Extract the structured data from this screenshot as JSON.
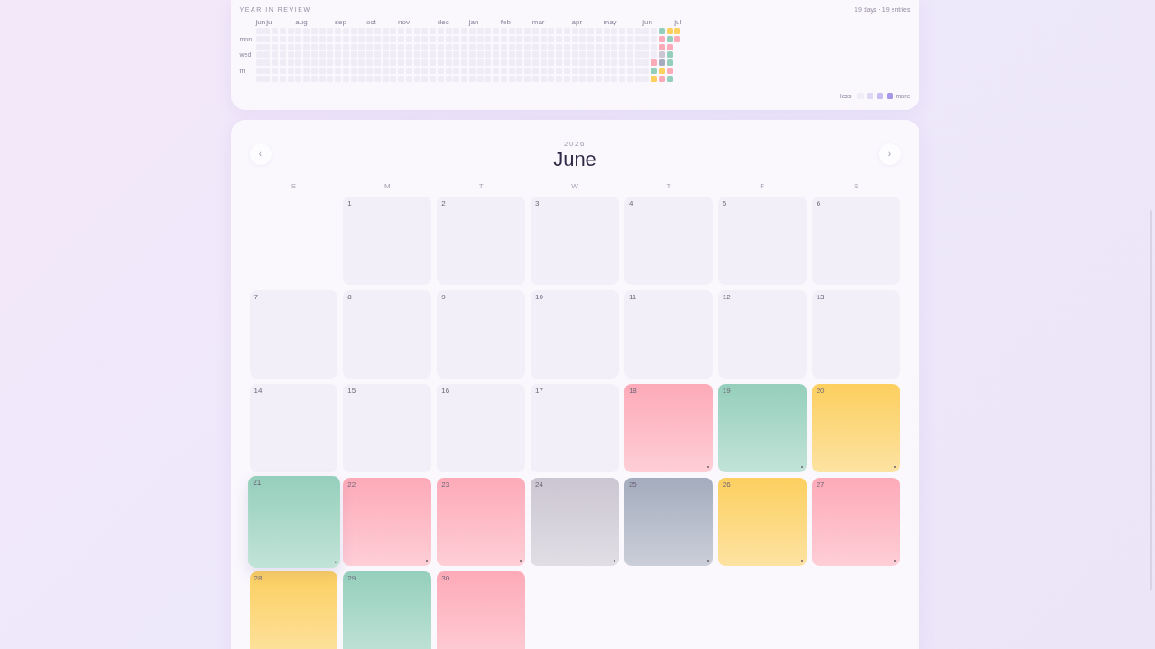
{
  "year_in_review": {
    "title": "YEAR IN REVIEW",
    "summary": "19 days · 19 entries",
    "day_labels": [
      "mon",
      "wed",
      "fri"
    ],
    "weeks": [
      {
        "month": "jun",
        "days": [
          {
            "color": "#f0ecf6"
          },
          {
            "color": "#f0ecf6"
          },
          {
            "color": "#f0ecf6"
          },
          {
            "color": "#f0ecf6"
          },
          {
            "color": "#f0ecf6"
          },
          {
            "color": "#f0ecf6"
          },
          {
            "color": "#f0ecf6"
          }
        ]
      },
      {
        "month": "jul",
        "days": [
          {
            "color": "#f0ecf6"
          },
          {
            "color": "#f0ecf6"
          },
          {
            "color": "#f0ecf6"
          },
          {
            "color": "#f0ecf6"
          },
          {
            "color": "#f0ecf6"
          },
          {
            "color": "#f0ecf6"
          },
          {
            "color": "#f0ecf6"
          }
        ]
      },
      {
        "days": [
          {
            "color": "#f0ecf6"
          },
          {
            "color": "#f0ecf6"
          },
          {
            "color": "#f0ecf6"
          },
          {
            "color": "#f0ecf6"
          },
          {
            "color": "#f0ecf6"
          },
          {
            "color": "#f0ecf6"
          },
          {
            "color": "#f0ecf6"
          }
        ]
      },
      {
        "days": [
          {
            "color": "#f0ecf6"
          },
          {
            "color": "#f0ecf6"
          },
          {
            "color": "#f0ecf6"
          },
          {
            "color": "#f0ecf6"
          },
          {
            "color": "#f0ecf6"
          },
          {
            "color": "#f0ecf6"
          },
          {
            "color": "#f0ecf6"
          }
        ]
      },
      {
        "days": [
          {
            "color": "#f0ecf6"
          },
          {
            "color": "#f0ecf6"
          },
          {
            "color": "#f0ecf6"
          },
          {
            "color": "#f0ecf6"
          },
          {
            "color": "#f0ecf6"
          },
          {
            "color": "#f0ecf6"
          },
          {
            "color": "#f0ecf6"
          }
        ]
      },
      {
        "month": "aug",
        "days": [
          {
            "color": "#f0ecf6"
          },
          {
            "color": "#f0ecf6"
          },
          {
            "color": "#f0ecf6"
          },
          {
            "color": "#f0ecf6"
          },
          {
            "color": "#f0ecf6"
          },
          {
            "color": "#f0ecf6"
          },
          {
            "color": "#f0ecf6"
          }
        ]
      },
      {
        "days": [
          {
            "color": "#f0ecf6"
          },
          {
            "color": "#f0ecf6"
          },
          {
            "color": "#f0ecf6"
          },
          {
            "color": "#f0ecf6"
          },
          {
            "color": "#f0ecf6"
          },
          {
            "color": "#f0ecf6"
          },
          {
            "color": "#f0ecf6"
          }
        ]
      },
      {
        "days": [
          {
            "color": "#f0ecf6"
          },
          {
            "color": "#f0ecf6"
          },
          {
            "color": "#f0ecf6"
          },
          {
            "color": "#f0ecf6"
          },
          {
            "color": "#f0ecf6"
          },
          {
            "color": "#f0ecf6"
          },
          {
            "color": "#f0ecf6"
          }
        ]
      },
      {
        "days": [
          {
            "color": "#f0ecf6"
          },
          {
            "color": "#f0ecf6"
          },
          {
            "color": "#f0ecf6"
          },
          {
            "color": "#f0ecf6"
          },
          {
            "color": "#f0ecf6"
          },
          {
            "color": "#f0ecf6"
          },
          {
            "color": "#f0ecf6"
          }
        ]
      },
      {
        "days": [
          {
            "color": "#f0ecf6"
          },
          {
            "color": "#f0ecf6"
          },
          {
            "color": "#f0ecf6"
          },
          {
            "color": "#f0ecf6"
          },
          {
            "color": "#f0ecf6"
          },
          {
            "color": "#f0ecf6"
          },
          {
            "color": "#f0ecf6"
          }
        ]
      },
      {
        "month": "sep",
        "days": [
          {
            "color": "#f0ecf6"
          },
          {
            "color": "#f0ecf6"
          },
          {
            "color": "#f0ecf6"
          },
          {
            "color": "#f0ecf6"
          },
          {
            "color": "#f0ecf6"
          },
          {
            "color": "#f0ecf6"
          },
          {
            "color": "#f0ecf6"
          }
        ]
      },
      {
        "days": [
          {
            "color": "#f0ecf6"
          },
          {
            "color": "#f0ecf6"
          },
          {
            "color": "#f0ecf6"
          },
          {
            "color": "#f0ecf6"
          },
          {
            "color": "#f0ecf6"
          },
          {
            "color": "#f0ecf6"
          },
          {
            "color": "#f0ecf6"
          }
        ]
      },
      {
        "days": [
          {
            "color": "#f0ecf6"
          },
          {
            "color": "#f0ecf6"
          },
          {
            "color": "#f0ecf6"
          },
          {
            "color": "#f0ecf6"
          },
          {
            "color": "#f0ecf6"
          },
          {
            "color": "#f0ecf6"
          },
          {
            "color": "#f0ecf6"
          }
        ]
      },
      {
        "days": [
          {
            "color": "#f0ecf6"
          },
          {
            "color": "#f0ecf6"
          },
          {
            "color": "#f0ecf6"
          },
          {
            "color": "#f0ecf6"
          },
          {
            "color": "#f0ecf6"
          },
          {
            "color": "#f0ecf6"
          },
          {
            "color": "#f0ecf6"
          }
        ]
      },
      {
        "month": "oct",
        "days": [
          {
            "color": "#f0ecf6"
          },
          {
            "color": "#f0ecf6"
          },
          {
            "color": "#f0ecf6"
          },
          {
            "color": "#f0ecf6"
          },
          {
            "color": "#f0ecf6"
          },
          {
            "color": "#f0ecf6"
          },
          {
            "color": "#f0ecf6"
          }
        ]
      },
      {
        "days": [
          {
            "color": "#f0ecf6"
          },
          {
            "color": "#f0ecf6"
          },
          {
            "color": "#f0ecf6"
          },
          {
            "color": "#f0ecf6"
          },
          {
            "color": "#f0ecf6"
          },
          {
            "color": "#f0ecf6"
          },
          {
            "color": "#f0ecf6"
          }
        ]
      },
      {
        "days": [
          {
            "color": "#f0ecf6"
          },
          {
            "color": "#f0ecf6"
          },
          {
            "color": "#f0ecf6"
          },
          {
            "color": "#f0ecf6"
          },
          {
            "color": "#f0ecf6"
          },
          {
            "color": "#f0ecf6"
          },
          {
            "color": "#f0ecf6"
          }
        ]
      },
      {
        "days": [
          {
            "color": "#f0ecf6"
          },
          {
            "color": "#f0ecf6"
          },
          {
            "color": "#f0ecf6"
          },
          {
            "color": "#f0ecf6"
          },
          {
            "color": "#f0ecf6"
          },
          {
            "color": "#f0ecf6"
          },
          {
            "color": "#f0ecf6"
          }
        ]
      },
      {
        "month": "nov",
        "days": [
          {
            "color": "#f0ecf6"
          },
          {
            "color": "#f0ecf6"
          },
          {
            "color": "#f0ecf6"
          },
          {
            "color": "#f0ecf6"
          },
          {
            "color": "#f0ecf6"
          },
          {
            "color": "#f0ecf6"
          },
          {
            "color": "#f0ecf6"
          }
        ]
      },
      {
        "days": [
          {
            "color": "#f0ecf6"
          },
          {
            "color": "#f0ecf6"
          },
          {
            "color": "#f0ecf6"
          },
          {
            "color": "#f0ecf6"
          },
          {
            "color": "#f0ecf6"
          },
          {
            "color": "#f0ecf6"
          },
          {
            "color": "#f0ecf6"
          }
        ]
      },
      {
        "days": [
          {
            "color": "#f0ecf6"
          },
          {
            "color": "#f0ecf6"
          },
          {
            "color": "#f0ecf6"
          },
          {
            "color": "#f0ecf6"
          },
          {
            "color": "#f0ecf6"
          },
          {
            "color": "#f0ecf6"
          },
          {
            "color": "#f0ecf6"
          }
        ]
      },
      {
        "days": [
          {
            "color": "#f0ecf6"
          },
          {
            "color": "#f0ecf6"
          },
          {
            "color": "#f0ecf6"
          },
          {
            "color": "#f0ecf6"
          },
          {
            "color": "#f0ecf6"
          },
          {
            "color": "#f0ecf6"
          },
          {
            "color": "#f0ecf6"
          }
        ]
      },
      {
        "days": [
          {
            "color": "#f0ecf6"
          },
          {
            "color": "#f0ecf6"
          },
          {
            "color": "#f0ecf6"
          },
          {
            "color": "#f0ecf6"
          },
          {
            "color": "#f0ecf6"
          },
          {
            "color": "#f0ecf6"
          },
          {
            "color": "#f0ecf6"
          }
        ]
      },
      {
        "month": "dec",
        "days": [
          {
            "color": "#f0ecf6"
          },
          {
            "color": "#f0ecf6"
          },
          {
            "color": "#f0ecf6"
          },
          {
            "color": "#f0ecf6"
          },
          {
            "color": "#f0ecf6"
          },
          {
            "color": "#f0ecf6"
          },
          {
            "color": "#f0ecf6"
          }
        ]
      },
      {
        "days": [
          {
            "color": "#f0ecf6"
          },
          {
            "color": "#f0ecf6"
          },
          {
            "color": "#f0ecf6"
          },
          {
            "color": "#f0ecf6"
          },
          {
            "color": "#f0ecf6"
          },
          {
            "color": "#f0ecf6"
          },
          {
            "color": "#f0ecf6"
          }
        ]
      },
      {
        "days": [
          {
            "color": "#f0ecf6"
          },
          {
            "color": "#f0ecf6"
          },
          {
            "color": "#f0ecf6"
          },
          {
            "color": "#f0ecf6"
          },
          {
            "color": "#f0ecf6"
          },
          {
            "color": "#f0ecf6"
          },
          {
            "color": "#f0ecf6"
          }
        ]
      },
      {
        "days": [
          {
            "color": "#f0ecf6"
          },
          {
            "color": "#f0ecf6"
          },
          {
            "color": "#f0ecf6"
          },
          {
            "color": "#f0ecf6"
          },
          {
            "color": "#f0ecf6"
          },
          {
            "color": "#f0ecf6"
          },
          {
            "color": "#f0ecf6"
          }
        ]
      },
      {
        "month": "jan",
        "days": [
          {
            "color": "#f0ecf6"
          },
          {
            "color": "#f0ecf6"
          },
          {
            "color": "#f0ecf6"
          },
          {
            "color": "#f0ecf6"
          },
          {
            "color": "#f0ecf6"
          },
          {
            "color": "#f0ecf6"
          },
          {
            "color": "#f0ecf6"
          }
        ]
      },
      {
        "days": [
          {
            "color": "#f0ecf6"
          },
          {
            "color": "#f0ecf6"
          },
          {
            "color": "#f0ecf6"
          },
          {
            "color": "#f0ecf6"
          },
          {
            "color": "#f0ecf6"
          },
          {
            "color": "#f0ecf6"
          },
          {
            "color": "#f0ecf6"
          }
        ]
      },
      {
        "days": [
          {
            "color": "#f0ecf6"
          },
          {
            "color": "#f0ecf6"
          },
          {
            "color": "#f0ecf6"
          },
          {
            "color": "#f0ecf6"
          },
          {
            "color": "#f0ecf6"
          },
          {
            "color": "#f0ecf6"
          },
          {
            "color": "#f0ecf6"
          }
        ]
      },
      {
        "days": [
          {
            "color": "#f0ecf6"
          },
          {
            "color": "#f0ecf6"
          },
          {
            "color": "#f0ecf6"
          },
          {
            "color": "#f0ecf6"
          },
          {
            "color": "#f0ecf6"
          },
          {
            "color": "#f0ecf6"
          },
          {
            "color": "#f0ecf6"
          }
        ]
      },
      {
        "month": "feb",
        "days": [
          {
            "color": "#f0ecf6"
          },
          {
            "color": "#f0ecf6"
          },
          {
            "color": "#f0ecf6"
          },
          {
            "color": "#f0ecf6"
          },
          {
            "color": "#f0ecf6"
          },
          {
            "color": "#f0ecf6"
          },
          {
            "color": "#f0ecf6"
          }
        ]
      },
      {
        "days": [
          {
            "color": "#f0ecf6"
          },
          {
            "color": "#f0ecf6"
          },
          {
            "color": "#f0ecf6"
          },
          {
            "color": "#f0ecf6"
          },
          {
            "color": "#f0ecf6"
          },
          {
            "color": "#f0ecf6"
          },
          {
            "color": "#f0ecf6"
          }
        ]
      },
      {
        "days": [
          {
            "color": "#f0ecf6"
          },
          {
            "color": "#f0ecf6"
          },
          {
            "color": "#f0ecf6"
          },
          {
            "color": "#f0ecf6"
          },
          {
            "color": "#f0ecf6"
          },
          {
            "color": "#f0ecf6"
          },
          {
            "color": "#f0ecf6"
          }
        ]
      },
      {
        "days": [
          {
            "color": "#f0ecf6"
          },
          {
            "color": "#f0ecf6"
          },
          {
            "color": "#f0ecf6"
          },
          {
            "color": "#f0ecf6"
          },
          {
            "color": "#f0ecf6"
          },
          {
            "color": "#f0ecf6"
          },
          {
            "color": "#f0ecf6"
          }
        ]
      },
      {
        "month": "mar",
        "days": [
          {
            "color": "#f0ecf6"
          },
          {
            "color": "#f0ecf6"
          },
          {
            "color": "#f0ecf6"
          },
          {
            "color": "#f0ecf6"
          },
          {
            "color": "#f0ecf6"
          },
          {
            "color": "#f0ecf6"
          },
          {
            "color": "#f0ecf6"
          }
        ]
      },
      {
        "days": [
          {
            "color": "#f0ecf6"
          },
          {
            "color": "#f0ecf6"
          },
          {
            "color": "#f0ecf6"
          },
          {
            "color": "#f0ecf6"
          },
          {
            "color": "#f0ecf6"
          },
          {
            "color": "#f0ecf6"
          },
          {
            "color": "#f0ecf6"
          }
        ]
      },
      {
        "days": [
          {
            "color": "#f0ecf6"
          },
          {
            "color": "#f0ecf6"
          },
          {
            "color": "#f0ecf6"
          },
          {
            "color": "#f0ecf6"
          },
          {
            "color": "#f0ecf6"
          },
          {
            "color": "#f0ecf6"
          },
          {
            "color": "#f0ecf6"
          }
        ]
      },
      {
        "days": [
          {
            "color": "#f0ecf6"
          },
          {
            "color": "#f0ecf6"
          },
          {
            "color": "#f0ecf6"
          },
          {
            "color": "#f0ecf6"
          },
          {
            "color": "#f0ecf6"
          },
          {
            "color": "#f0ecf6"
          },
          {
            "color": "#f0ecf6"
          }
        ]
      },
      {
        "days": [
          {
            "color": "#f0ecf6"
          },
          {
            "color": "#f0ecf6"
          },
          {
            "color": "#f0ecf6"
          },
          {
            "color": "#f0ecf6"
          },
          {
            "color": "#f0ecf6"
          },
          {
            "color": "#f0ecf6"
          },
          {
            "color": "#f0ecf6"
          }
        ]
      },
      {
        "month": "apr",
        "days": [
          {
            "color": "#f0ecf6"
          },
          {
            "color": "#f0ecf6"
          },
          {
            "color": "#f0ecf6"
          },
          {
            "color": "#f0ecf6"
          },
          {
            "color": "#f0ecf6"
          },
          {
            "color": "#f0ecf6"
          },
          {
            "color": "#f0ecf6"
          }
        ]
      },
      {
        "days": [
          {
            "color": "#f0ecf6"
          },
          {
            "color": "#f0ecf6"
          },
          {
            "color": "#f0ecf6"
          },
          {
            "color": "#f0ecf6"
          },
          {
            "color": "#f0ecf6"
          },
          {
            "color": "#f0ecf6"
          },
          {
            "color": "#f0ecf6"
          }
        ]
      },
      {
        "days": [
          {
            "color": "#f0ecf6"
          },
          {
            "color": "#f0ecf6"
          },
          {
            "color": "#f0ecf6"
          },
          {
            "color": "#f0ecf6"
          },
          {
            "color": "#f0ecf6"
          },
          {
            "color": "#f0ecf6"
          },
          {
            "color": "#f0ecf6"
          }
        ]
      },
      {
        "days": [
          {
            "color": "#f0ecf6"
          },
          {
            "color": "#f0ecf6"
          },
          {
            "color": "#f0ecf6"
          },
          {
            "color": "#f0ecf6"
          },
          {
            "color": "#f0ecf6"
          },
          {
            "color": "#f0ecf6"
          },
          {
            "color": "#f0ecf6"
          }
        ]
      },
      {
        "month": "may",
        "days": [
          {
            "color": "#f0ecf6"
          },
          {
            "color": "#f0ecf6"
          },
          {
            "color": "#f0ecf6"
          },
          {
            "color": "#f0ecf6"
          },
          {
            "color": "#f0ecf6"
          },
          {
            "color": "#f0ecf6"
          },
          {
            "color": "#f0ecf6"
          }
        ]
      },
      {
        "days": [
          {
            "color": "#f0ecf6"
          },
          {
            "color": "#f0ecf6"
          },
          {
            "color": "#f0ecf6"
          },
          {
            "color": "#f0ecf6"
          },
          {
            "color": "#f0ecf6"
          },
          {
            "color": "#f0ecf6"
          },
          {
            "color": "#f0ecf6"
          }
        ]
      },
      {
        "days": [
          {
            "color": "#f0ecf6"
          },
          {
            "color": "#f0ecf6"
          },
          {
            "color": "#f0ecf6"
          },
          {
            "color": "#f0ecf6"
          },
          {
            "color": "#f0ecf6"
          },
          {
            "color": "#f0ecf6"
          },
          {
            "color": "#f0ecf6"
          }
        ]
      },
      {
        "days": [
          {
            "color": "#f0ecf6"
          },
          {
            "color": "#f0ecf6"
          },
          {
            "color": "#f0ecf6"
          },
          {
            "color": "#f0ecf6"
          },
          {
            "color": "#f0ecf6"
          },
          {
            "color": "#f0ecf6"
          },
          {
            "color": "#f0ecf6"
          }
        ]
      },
      {
        "days": [
          {
            "color": "#f0ecf6"
          },
          {
            "color": "#f0ecf6"
          },
          {
            "color": "#f0ecf6"
          },
          {
            "color": "#f0ecf6"
          },
          {
            "color": "#f0ecf6"
          },
          {
            "color": "#f0ecf6"
          },
          {
            "color": "#f0ecf6"
          }
        ]
      },
      {
        "month": "jun",
        "days": [
          {
            "color": "#f0ecf6"
          },
          {
            "color": "#f0ecf6"
          },
          {
            "color": "#f0ecf6"
          },
          {
            "color": "#f0ecf6"
          },
          {
            "color": "#f0ecf6"
          },
          {
            "color": "#f0ecf6"
          },
          {
            "color": "#f0ecf6"
          }
        ]
      },
      {
        "days": [
          {
            "color": "#f0ecf6"
          },
          {
            "color": "#f0ecf6"
          },
          {
            "color": "#f0ecf6"
          },
          {
            "color": "#f0ecf6"
          },
          {
            "color": "#fdaab8"
          },
          {
            "color": "#95cfbb"
          },
          {
            "color": "#fccf5f"
          }
        ]
      },
      {
        "days": [
          {
            "color": "#95cfbb"
          },
          {
            "color": "#fdaab8"
          },
          {
            "color": "#fdaab8"
          },
          {
            "color": "#cbc6d2"
          },
          {
            "color": "#a4acbd"
          },
          {
            "color": "#fccf5f"
          },
          {
            "color": "#fdaab8"
          }
        ]
      },
      {
        "days": [
          {
            "color": "#fccf5f"
          },
          {
            "color": "#95cfbb"
          },
          {
            "color": "#fdaab8"
          },
          {
            "color": "#95cfbb"
          },
          {
            "color": "#95cfbb"
          },
          {
            "color": "#fdaab8"
          },
          {
            "color": "#95cfbb"
          }
        ]
      },
      {
        "month": "jul",
        "days": [
          {
            "color": "#fccf5f"
          },
          {
            "color": "#fdaab8"
          }
        ]
      }
    ],
    "legend": {
      "less": "less",
      "swatches": [
        {
          "color": "#f1edf7"
        },
        {
          "color": "#e1d8f3"
        },
        {
          "color": "#c9bcf0"
        },
        {
          "color": "#a897e8"
        }
      ],
      "more": "more"
    }
  },
  "calendar": {
    "prev": "‹",
    "year": "2026",
    "month": "June",
    "next": "›",
    "weekdays": [
      "S",
      "M",
      "T",
      "W",
      "T",
      "F",
      "S"
    ],
    "cells": [
      {
        "kind": "blank"
      },
      {
        "kind": "day",
        "day": "1",
        "entry": false,
        "selected": false
      },
      {
        "kind": "day",
        "day": "2",
        "entry": false,
        "selected": false
      },
      {
        "kind": "day",
        "day": "3",
        "entry": false,
        "selected": false
      },
      {
        "kind": "day",
        "day": "4",
        "entry": false,
        "selected": false
      },
      {
        "kind": "day",
        "day": "5",
        "entry": false,
        "selected": false
      },
      {
        "kind": "day",
        "day": "6",
        "entry": false,
        "selected": false
      },
      {
        "kind": "day",
        "day": "7",
        "entry": false,
        "selected": false
      },
      {
        "kind": "day",
        "day": "8",
        "entry": false,
        "selected": false
      },
      {
        "kind": "day",
        "day": "9",
        "entry": false,
        "selected": false
      },
      {
        "kind": "day",
        "day": "10",
        "entry": false,
        "selected": false
      },
      {
        "kind": "day",
        "day": "11",
        "entry": false,
        "selected": false
      },
      {
        "kind": "day",
        "day": "12",
        "entry": false,
        "selected": false
      },
      {
        "kind": "day",
        "day": "13",
        "entry": false,
        "selected": false
      },
      {
        "kind": "day",
        "day": "14",
        "entry": false,
        "selected": false
      },
      {
        "kind": "day",
        "day": "15",
        "entry": false,
        "selected": false
      },
      {
        "kind": "day",
        "day": "16",
        "entry": false,
        "selected": false
      },
      {
        "kind": "day",
        "day": "17",
        "entry": false,
        "selected": false
      },
      {
        "kind": "day",
        "day": "18",
        "color": "#fdaab8",
        "entry": true,
        "selected": false
      },
      {
        "kind": "day",
        "day": "19",
        "color": "#95cfbb",
        "entry": true,
        "selected": false
      },
      {
        "kind": "day",
        "day": "20",
        "color": "#fccf5f",
        "entry": true,
        "selected": false
      },
      {
        "kind": "day",
        "day": "21",
        "color": "#95cfbb",
        "entry": true,
        "selected": true
      },
      {
        "kind": "day",
        "day": "22",
        "color": "#fdaab8",
        "entry": true,
        "selected": false
      },
      {
        "kind": "day",
        "day": "23",
        "color": "#fdaab8",
        "entry": true,
        "selected": false
      },
      {
        "kind": "day",
        "day": "24",
        "color": "#cbc6d2",
        "entry": true,
        "selected": false
      },
      {
        "kind": "day",
        "day": "25",
        "color": "#a4acbd",
        "entry": true,
        "selected": false
      },
      {
        "kind": "day",
        "day": "26",
        "color": "#fccf5f",
        "entry": true,
        "selected": false
      },
      {
        "kind": "day",
        "day": "27",
        "color": "#fdaab8",
        "entry": true,
        "selected": false
      },
      {
        "kind": "day",
        "day": "28",
        "color": "#fccf5f",
        "selected": false
      },
      {
        "kind": "day",
        "day": "29",
        "color": "#95cfbb",
        "selected": false
      },
      {
        "kind": "day",
        "day": "30",
        "color": "#fdaab8",
        "selected": false
      }
    ]
  }
}
